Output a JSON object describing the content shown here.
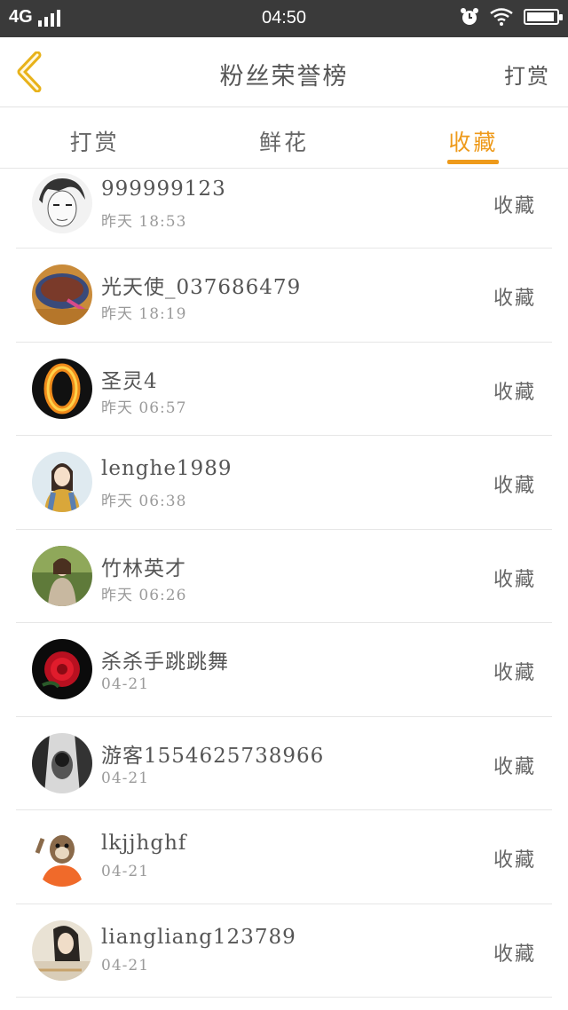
{
  "status_bar": {
    "network": "4G",
    "time": "04:50",
    "battery_level": 0.95
  },
  "header": {
    "title": "粉丝荣誉榜",
    "right_label": "打赏",
    "back_icon": "chevron-left-icon"
  },
  "tabs": [
    {
      "label": "打赏",
      "active": false
    },
    {
      "label": "鲜花",
      "active": false
    },
    {
      "label": "收藏",
      "active": true
    }
  ],
  "colors": {
    "accent": "#ee9a1b",
    "status_bar_bg": "#3a3a3a",
    "text_primary": "#555555",
    "text_secondary": "#9a9a9a"
  },
  "items": [
    {
      "name": "999999123",
      "time": "昨天 18:53",
      "action": "收藏"
    },
    {
      "name": "光天使_037686479",
      "time": "昨天 18:19",
      "action": "收藏"
    },
    {
      "name": "圣灵4",
      "time": "昨天 06:57",
      "action": "收藏"
    },
    {
      "name": "lenghe1989",
      "time": "昨天 06:38",
      "action": "收藏"
    },
    {
      "name": "竹林英才",
      "time": "昨天 06:26",
      "action": "收藏"
    },
    {
      "name": "杀杀手跳跳舞",
      "time": "04-21",
      "action": "收藏"
    },
    {
      "name": "游客1554625738966",
      "time": "04-21",
      "action": "收藏"
    },
    {
      "name": "lkjjhghf",
      "time": "04-21",
      "action": "收藏"
    },
    {
      "name": "liangliang123789",
      "time": "04-21",
      "action": "收藏"
    }
  ]
}
